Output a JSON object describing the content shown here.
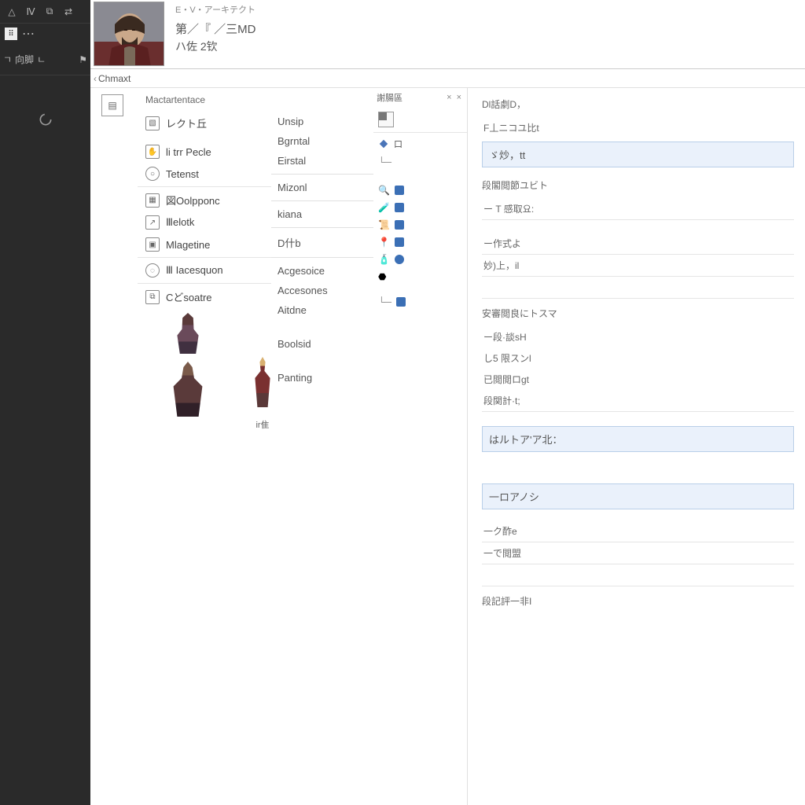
{
  "header": {
    "subtitle": "E・V・アーキテクト",
    "title1": "第／『 ／三MD",
    "title2": "ハ佐 2钦"
  },
  "crumb": {
    "label": "Chmaxt"
  },
  "panel": {
    "title": "Mactartentace"
  },
  "nav": {
    "items": [
      {
        "label": "レクト丘"
      },
      {
        "label": "li trr Pecle"
      },
      {
        "label": "Tetenst"
      },
      {
        "label": "図Oolpponc"
      },
      {
        "label": "Ⅲelotk"
      },
      {
        "label": "Mlagetine"
      },
      {
        "label": "Ⅲ Iacesquon"
      },
      {
        "label": "Cどsoatre"
      }
    ]
  },
  "col_c": {
    "items": [
      "Unsip",
      "Bgrntal",
      "Eirstal",
      "Mizonl",
      "kiana",
      "D什b",
      "Acgesoice",
      "Accesones",
      "Aitdne",
      "Boolsid",
      "Panting"
    ],
    "caption": "ir隹"
  },
  "col_d": {
    "header": "謝腸區",
    "slot_label": "口"
  },
  "col_e": {
    "sec1": "Dl話劇D，",
    "line1": "F丄ニコユ比t",
    "hl1": "ゞ炒，tt",
    "sec2": "段閣閲節ユビト",
    "line2": "ー T 感取요:",
    "line3": "ー作式よ",
    "line4": "妙)上，il",
    "sec3": "安審閲良にトスマ",
    "sub1": "ー段·談sH",
    "sub2": "し5 限スンl",
    "sub3": "已閲閲ロgt",
    "sub4": "段関計·t;",
    "hl2": "はルトア'ア北：",
    "hl3": "一ロアノシ",
    "line5": "一ク酢e",
    "line6": "一で閲盟",
    "sec4": "段記評一非I"
  }
}
